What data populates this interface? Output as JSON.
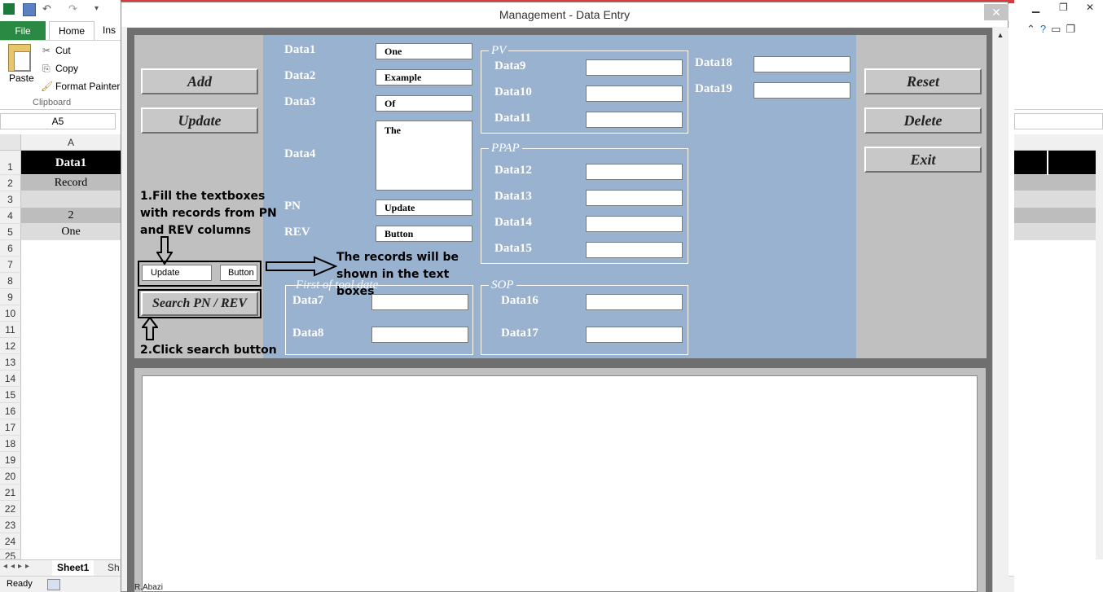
{
  "excel": {
    "tabs": {
      "file": "File",
      "home": "Home",
      "insert": "Ins"
    },
    "clipboard": {
      "paste": "Paste",
      "cut": "Cut",
      "copy": "Copy",
      "format_painter": "Format Painter",
      "group": "Clipboard"
    },
    "name_box": "A5",
    "column_header": "A",
    "rows": [
      "1",
      "2",
      "3",
      "4",
      "5",
      "6",
      "7",
      "8",
      "9",
      "10",
      "11",
      "12",
      "13",
      "14",
      "15",
      "16",
      "17",
      "18",
      "19",
      "20",
      "21",
      "22",
      "23",
      "24",
      "25"
    ],
    "cells": {
      "r1": "Data1",
      "r2": "Record",
      "r4": "2",
      "r5": "One"
    },
    "sheet_tab": "Sheet1",
    "sheet_tab2": "Sh",
    "status": "Ready"
  },
  "form": {
    "title": "Management - Data Entry",
    "close": "✕",
    "buttons": {
      "add": "Add",
      "update": "Update",
      "reset": "Reset",
      "delete": "Delete",
      "exit": "Exit",
      "search": "Search PN / REV"
    },
    "search_fields": {
      "pn": "Update",
      "rev": "Button"
    },
    "labels": {
      "data1": "Data1",
      "data2": "Data2",
      "data3": "Data3",
      "data4": "Data4",
      "pn": "PN",
      "rev": "REV",
      "data7": "Data7",
      "data8": "Data8",
      "data9": "Data9",
      "data10": "Data10",
      "data11": "Data11",
      "data12": "Data12",
      "data13": "Data13",
      "data14": "Data14",
      "data15": "Data15",
      "data16": "Data16",
      "data17": "Data17",
      "data18": "Data18",
      "data19": "Data19"
    },
    "values": {
      "data1": "One",
      "data2": "Example",
      "data3": "Of",
      "data4": "The",
      "pn": "Update",
      "rev": "Button"
    },
    "frames": {
      "pv": "PV",
      "ppap": "PPAP",
      "first_tool": "First of tool date",
      "sop": "SOP"
    },
    "annotations": {
      "step1": [
        "1.Fill the textboxes",
        "with records from PN",
        "and REV columns"
      ],
      "step2": "2.Click search button",
      "result": [
        "The records will be",
        "shown in the text",
        "boxes"
      ]
    },
    "footer": "R.Abazi"
  }
}
